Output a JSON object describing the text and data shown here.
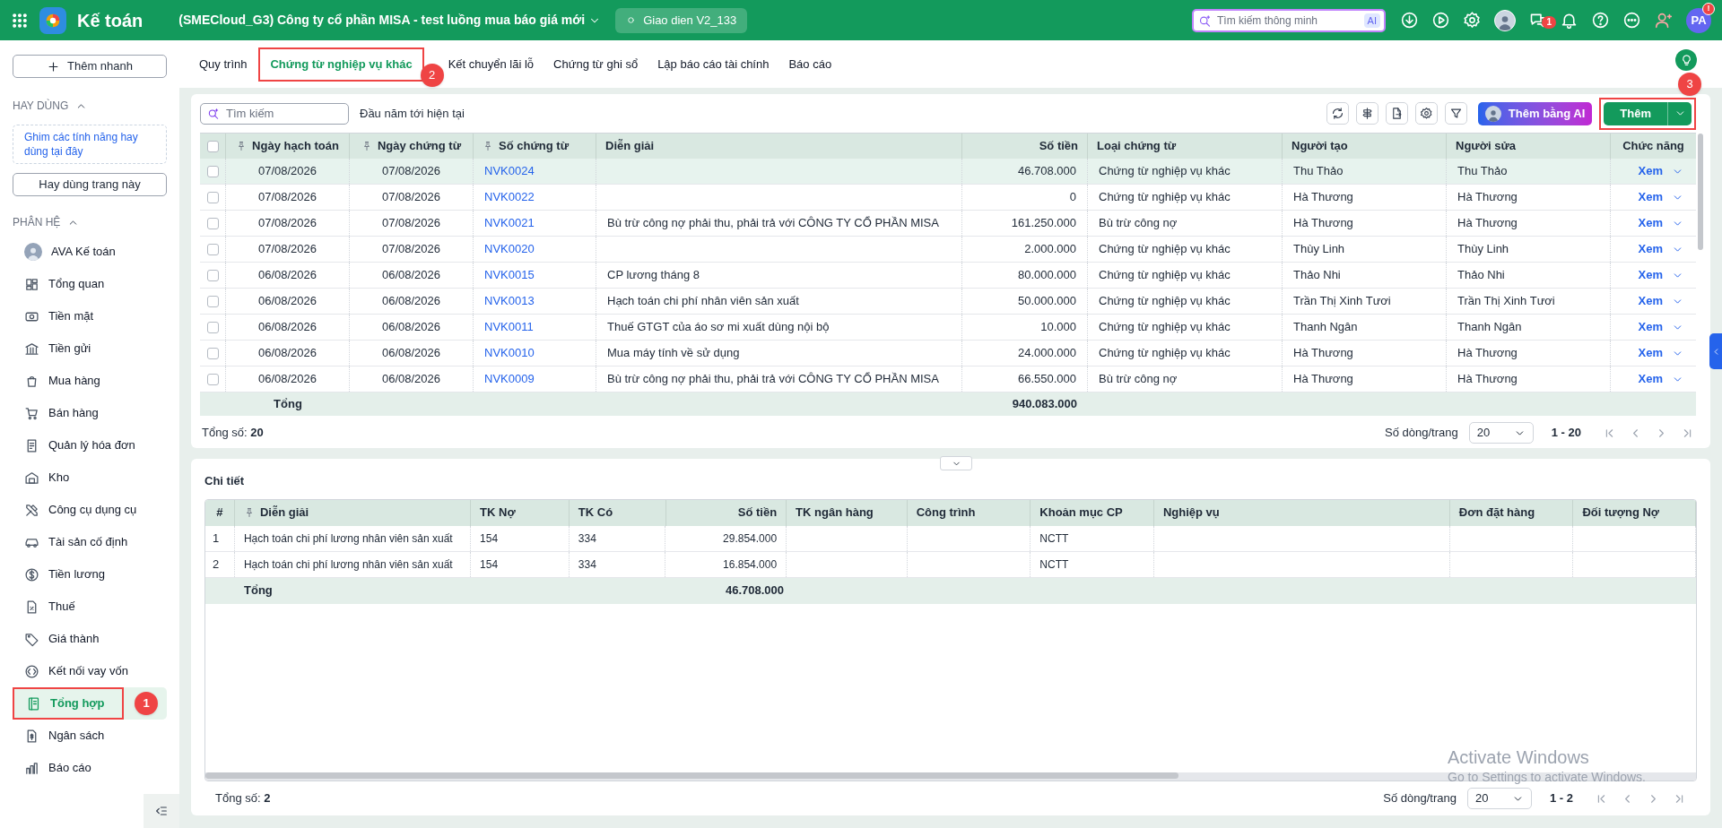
{
  "app": {
    "name": "Kế toán",
    "company": "(SMECloud_G3) Công ty cổ phần MISA - test luồng mua báo giá mới",
    "version": "Giao dien V2_133",
    "search_placeholder": "Tìm kiếm thông minh",
    "ai_badge": "AI",
    "chat_badge": "1",
    "user_initials": "PA",
    "user_badge": "!"
  },
  "sidebar": {
    "quick_add": "Thêm nhanh",
    "favorites_title": "HAY DÙNG",
    "favorites_hint": "Ghim các tính năng hay dùng tại đây",
    "favorite_button": "Hay dùng trang này",
    "modules_title": "PHÂN HỆ",
    "items": [
      {
        "label": "AVA Kế toán",
        "selected": false
      },
      {
        "label": "Tổng quan",
        "selected": false
      },
      {
        "label": "Tiền mặt",
        "selected": false
      },
      {
        "label": "Tiền gửi",
        "selected": false
      },
      {
        "label": "Mua hàng",
        "selected": false
      },
      {
        "label": "Bán hàng",
        "selected": false
      },
      {
        "label": "Quản lý hóa đơn",
        "selected": false
      },
      {
        "label": "Kho",
        "selected": false
      },
      {
        "label": "Công cụ dụng cụ",
        "selected": false
      },
      {
        "label": "Tài sản cố định",
        "selected": false
      },
      {
        "label": "Tiền lương",
        "selected": false
      },
      {
        "label": "Thuế",
        "selected": false
      },
      {
        "label": "Giá thành",
        "selected": false
      },
      {
        "label": "Kết nối vay vốn",
        "selected": false
      },
      {
        "label": "Tổng hợp",
        "selected": true,
        "annotation": "1"
      },
      {
        "label": "Ngân sách",
        "selected": false
      },
      {
        "label": "Báo cáo",
        "selected": false
      }
    ]
  },
  "tabs": [
    {
      "label": "Quy trình",
      "selected": false
    },
    {
      "label": "Chứng từ nghiệp vụ khác",
      "selected": true,
      "annotation": "2"
    },
    {
      "label": "Kết chuyển lãi lỗ",
      "selected": false
    },
    {
      "label": "Chứng từ ghi sổ",
      "selected": false
    },
    {
      "label": "Lập báo cáo tài chính",
      "selected": false
    },
    {
      "label": "Báo cáo",
      "selected": false
    }
  ],
  "toolbar": {
    "search_placeholder": "Tìm kiếm",
    "period": "Đầu năm tới hiện tại",
    "ai_button": "Thêm bằng AI",
    "add_button": "Thêm",
    "add_annotation": "3"
  },
  "table": {
    "select_all_checked": false,
    "columns": [
      {
        "label": "Ngày hạch toán",
        "pinned": true
      },
      {
        "label": "Ngày chứng từ",
        "pinned": true
      },
      {
        "label": "Số chứng từ",
        "pinned": true
      },
      {
        "label": "Diễn giải",
        "pinned": false
      },
      {
        "label": "Số tiền",
        "pinned": false
      },
      {
        "label": "Loại chứng từ",
        "pinned": false
      },
      {
        "label": "Người tạo",
        "pinned": false
      },
      {
        "label": "Người sửa",
        "pinned": false
      },
      {
        "label": "Chức năng",
        "pinned": false
      }
    ],
    "rows": [
      {
        "selected": true,
        "checked": false,
        "cells": [
          "07/08/2026",
          "07/08/2026",
          "NVK0024",
          "",
          "46.708.000",
          "Chứng từ nghiệp vụ khác",
          "Thu Thảo",
          "Thu Thảo"
        ],
        "action": "Xem"
      },
      {
        "selected": false,
        "checked": false,
        "cells": [
          "07/08/2026",
          "07/08/2026",
          "NVK0022",
          "",
          "0",
          "Chứng từ nghiệp vụ khác",
          "Hà Thương",
          "Hà Thương"
        ],
        "action": "Xem"
      },
      {
        "selected": false,
        "checked": false,
        "cells": [
          "07/08/2026",
          "07/08/2026",
          "NVK0021",
          "Bù trừ công nợ phải thu, phải trả với CÔNG TY CỔ PHẦN MISA",
          "161.250.000",
          "Bù trừ công nợ",
          "Hà Thương",
          "Hà Thương"
        ],
        "action": "Xem"
      },
      {
        "selected": false,
        "checked": false,
        "cells": [
          "07/08/2026",
          "07/08/2026",
          "NVK0020",
          "",
          "2.000.000",
          "Chứng từ nghiệp vụ khác",
          "Thùy Linh",
          "Thùy Linh"
        ],
        "action": "Xem"
      },
      {
        "selected": false,
        "checked": false,
        "cells": [
          "06/08/2026",
          "06/08/2026",
          "NVK0015",
          "CP lương tháng 8",
          "80.000.000",
          "Chứng từ nghiệp vụ khác",
          "Thảo Nhi",
          "Thảo Nhi"
        ],
        "action": "Xem"
      },
      {
        "selected": false,
        "checked": false,
        "cells": [
          "06/08/2026",
          "06/08/2026",
          "NVK0013",
          "Hạch toán chi phí nhân viên sản xuất",
          "50.000.000",
          "Chứng từ nghiệp vụ khác",
          "Trần Thị Xinh Tươi",
          "Trần Thị Xinh Tươi"
        ],
        "action": "Xem"
      },
      {
        "selected": false,
        "checked": false,
        "cells": [
          "06/08/2026",
          "06/08/2026",
          "NVK0011",
          "Thuế GTGT của áo sơ mi xuất dùng nội bộ",
          "10.000",
          "Chứng từ nghiệp vụ khác",
          "Thanh Ngân",
          "Thanh Ngân"
        ],
        "action": "Xem"
      },
      {
        "selected": false,
        "checked": false,
        "cells": [
          "06/08/2026",
          "06/08/2026",
          "NVK0010",
          "Mua máy tính về sử dụng",
          "24.000.000",
          "Chứng từ nghiệp vụ khác",
          "Hà Thương",
          "Hà Thương"
        ],
        "action": "Xem"
      },
      {
        "selected": false,
        "checked": false,
        "cells": [
          "06/08/2026",
          "06/08/2026",
          "NVK0009",
          "Bù trừ công nợ phải thu, phải trả với CÔNG TY CỔ PHẦN MISA",
          "66.550.000",
          "Bù trừ công nợ",
          "Hà Thương",
          "Hà Thương"
        ],
        "action": "Xem"
      }
    ],
    "total_label": "Tổng",
    "total_amount": "940.083.000",
    "count": "Tổng số: **20**",
    "page_size_label": "Số dòng/trang",
    "page_size": "20",
    "range": "1 - 20"
  },
  "detail": {
    "title": "Chi tiết",
    "columns": [
      {
        "label": "#",
        "pinned": false
      },
      {
        "label": "Diễn giải",
        "pinned": true
      },
      {
        "label": "TK Nợ",
        "pinned": false
      },
      {
        "label": "TK Có",
        "pinned": false
      },
      {
        "label": "Số tiền",
        "pinned": false
      },
      {
        "label": "TK ngân hàng",
        "pinned": false
      },
      {
        "label": "Công trình",
        "pinned": false
      },
      {
        "label": "Khoản mục CP",
        "pinned": false
      },
      {
        "label": "Nghiệp vụ",
        "pinned": false
      },
      {
        "label": "Đơn đặt hàng",
        "pinned": false
      },
      {
        "label": "Đối tượng Nợ",
        "pinned": false
      }
    ],
    "rows": [
      {
        "cells": [
          "1",
          "Hạch toán chi phí lương nhân viên sản xuất",
          "154",
          "334",
          "29.854.000",
          "",
          "",
          "NCTT",
          "",
          "",
          ""
        ]
      },
      {
        "cells": [
          "2",
          "Hạch toán chi phí lương nhân viên sản xuất",
          "154",
          "334",
          "16.854.000",
          "",
          "",
          "NCTT",
          "",
          "",
          ""
        ]
      }
    ],
    "total_label": "Tổng",
    "total_amount": "46.708.000",
    "count": "Tổng số: **2**",
    "page_size_label": "Số dòng/trang",
    "page_size": "20",
    "range": "1 - 2"
  },
  "os_notice": {
    "title": "Activate Windows",
    "text": "Go to Settings to activate Windows."
  }
}
